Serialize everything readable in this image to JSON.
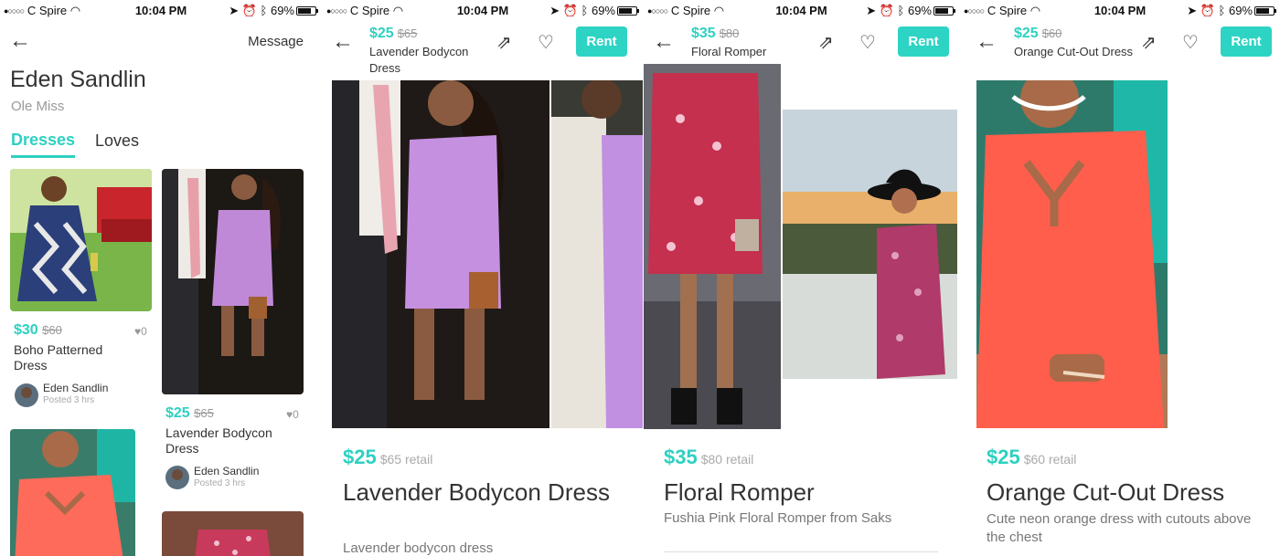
{
  "status": {
    "carrier": "C Spire",
    "time": "10:04 PM",
    "battery": "69%"
  },
  "profile": {
    "message_label": "Message",
    "name": "Eden Sandlin",
    "school": "Ole Miss",
    "tabs": [
      {
        "label": "Dresses"
      },
      {
        "label": "Loves"
      }
    ],
    "items": [
      {
        "price": "$30",
        "orig": "$60",
        "likes": "0",
        "title": "Boho Patterned Dress",
        "seller": "Eden Sandlin",
        "posted": "Posted 3 hrs"
      },
      {
        "price": "$25",
        "orig": "$65",
        "likes": "0",
        "title": "Lavender Bodycon Dress",
        "seller": "Eden Sandlin",
        "posted": "Posted 3 hrs"
      }
    ]
  },
  "details": [
    {
      "price": "$25",
      "orig": "$65",
      "header_title": "Lavender Bodycon Dress",
      "retail": "$65 retail",
      "title": "Lavender Bodycon Dress",
      "description": "Lavender bodycon dress",
      "rent_label": "Rent"
    },
    {
      "price": "$35",
      "orig": "$80",
      "header_title": "Floral Romper",
      "retail": "$80 retail",
      "title": "Floral Romper",
      "description": "Fushia Pink Floral Romper from Saks",
      "rent_label": "Rent"
    },
    {
      "price": "$25",
      "orig": "$60",
      "header_title": "Orange Cut-Out Dress",
      "retail": "$60 retail",
      "title": "Orange Cut-Out Dress",
      "description": "Cute neon orange dress with cutouts above the chest",
      "rent_label": "Rent"
    }
  ],
  "colors": {
    "accent": "#2dd4c4",
    "rent_button": "#2dd4c4"
  }
}
